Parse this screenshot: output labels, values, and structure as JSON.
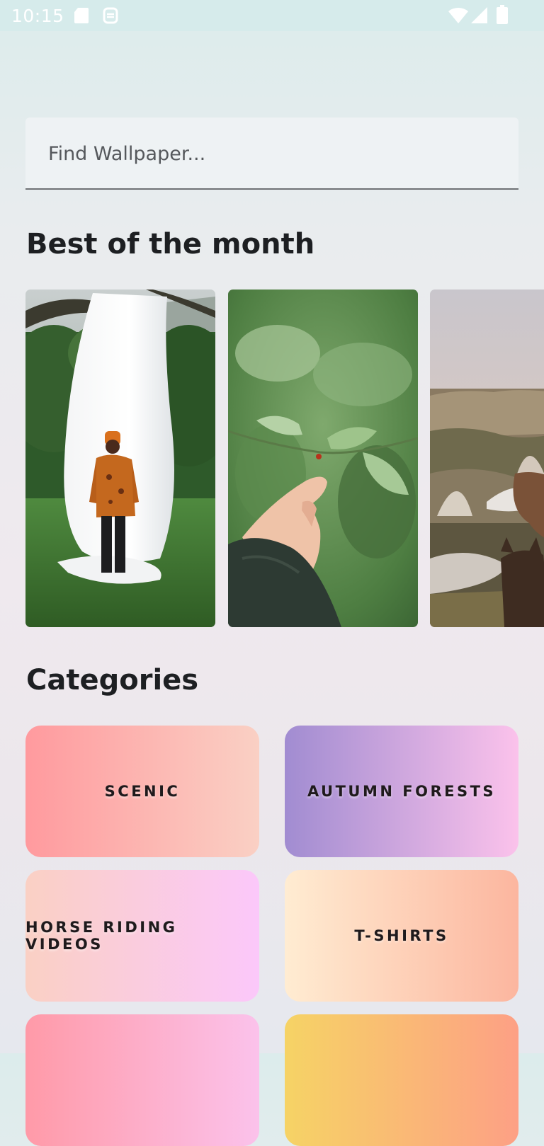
{
  "status_bar": {
    "time": "10:15",
    "icons": [
      "sd-card-icon",
      "sim-icon",
      "wifi-icon",
      "signal-icon",
      "battery-icon"
    ]
  },
  "search": {
    "placeholder": "Find Wallpaper..."
  },
  "best_of_month": {
    "title": "Best of the month",
    "photos": [
      {
        "subject": "person-with-white-cloth"
      },
      {
        "subject": "hand-with-ladybug-leaves"
      },
      {
        "subject": "cappadocia-landscape-dogs"
      }
    ]
  },
  "categories": {
    "title": "Categories",
    "items": [
      {
        "label": "SCENIC",
        "colors": [
          "#ff9a9e",
          "#fad0c4"
        ]
      },
      {
        "label": "AUTUMN FORESTS",
        "colors": [
          "#a18cd1",
          "#fbc2eb"
        ]
      },
      {
        "label": "HORSE RIDING VIDEOS",
        "colors": [
          "#fad0c4",
          "#fbc8fa"
        ]
      },
      {
        "label": "T-SHIRTS",
        "colors": [
          "#ffecd2",
          "#fcb69f"
        ]
      },
      {
        "label": "",
        "colors": [
          "#ff9aa8",
          "#fbc2eb"
        ]
      },
      {
        "label": "",
        "colors": [
          "#f6d365",
          "#fda085"
        ]
      }
    ]
  }
}
